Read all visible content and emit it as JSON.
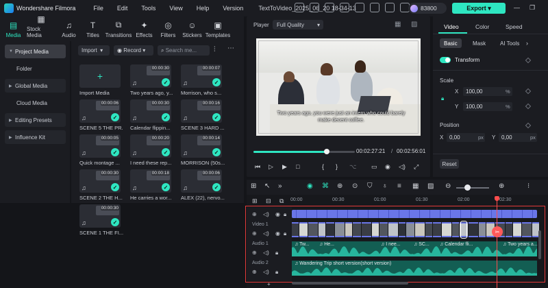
{
  "titlebar": {
    "app_name": "Wondershare Filmora",
    "menus": [
      "File",
      "Edit",
      "Tools",
      "View",
      "Help",
      "Version"
    ],
    "project_name": "TextToVideo_2025_06_20 18-34-13",
    "credits": "83800",
    "export_label": "Export"
  },
  "media_tabs": [
    {
      "label": "Media",
      "icon": "media-icon",
      "active": true
    },
    {
      "label": "Stock Media",
      "icon": "stock-media-icon"
    },
    {
      "label": "Audio",
      "icon": "audio-icon"
    },
    {
      "label": "Titles",
      "icon": "titles-icon"
    },
    {
      "label": "Transitions",
      "icon": "transitions-icon"
    },
    {
      "label": "Effects",
      "icon": "effects-icon"
    },
    {
      "label": "Filters",
      "icon": "filters-icon"
    },
    {
      "label": "Stickers",
      "icon": "stickers-icon"
    },
    {
      "label": "Templates",
      "icon": "templates-icon"
    }
  ],
  "leftnav": {
    "items": [
      {
        "label": "Project Media",
        "selected": true,
        "arrow": true
      },
      {
        "label": "Folder",
        "sub": true
      },
      {
        "label": "Global Media",
        "arrow": true
      },
      {
        "label": "Cloud Media",
        "sub": true
      },
      {
        "label": "Editing Presets",
        "arrow": true
      },
      {
        "label": "Influence Kit",
        "arrow": true
      }
    ]
  },
  "media": {
    "import_label": "Import",
    "record_label": "Record",
    "search_placeholder": "Search me...",
    "import_card_label": "Import Media",
    "items": [
      {
        "label": "Two years ago, y...",
        "duration": "00:00:30"
      },
      {
        "label": "Morrison, who s...",
        "duration": "00:00:07"
      },
      {
        "label": "SCENE 5 THE PR...",
        "duration": "00:00:06"
      },
      {
        "label": "Calendar flippin...",
        "duration": "00:00:30"
      },
      {
        "label": "SCENE 3 HARD ...",
        "duration": "00:00:16"
      },
      {
        "label": "Quick montage ...",
        "duration": "00:00:05"
      },
      {
        "label": "I need these rep...",
        "duration": "00:00:20"
      },
      {
        "label": "MORRISON (50s...",
        "duration": "00:00:14"
      },
      {
        "label": "SCENE 2 THE H...",
        "duration": "00:00:30"
      },
      {
        "label": "He carries a wor...",
        "duration": "00:00:18"
      },
      {
        "label": "ALEX (22), nervo...",
        "duration": "00:00:06"
      },
      {
        "label": "SCENE 1 THE FI...",
        "duration": "00:00:30"
      }
    ]
  },
  "player": {
    "label": "Player",
    "quality": "Full Quality",
    "caption": "Two years ago, you were just an intern who could barely make decent coffee.",
    "current_time": "00:02:27:21",
    "separator": "/",
    "total_time": "00:02:56:01",
    "progress": 0.72
  },
  "properties": {
    "tabs": [
      "Video",
      "Color",
      "Speed"
    ],
    "subtabs": [
      "Basic",
      "Mask",
      "AI Tools"
    ],
    "transform_label": "Transform",
    "scale_label": "Scale",
    "scale_x": "100,00",
    "scale_y": "100,00",
    "scale_unit": "%",
    "position_label": "Position",
    "pos_x": "0,00",
    "pos_y": "0,00",
    "pos_unit": "px",
    "x_label": "X",
    "y_label": "Y",
    "reset_label": "Reset"
  },
  "timeline": {
    "ruler": [
      "00:00",
      "00:30",
      "01:00",
      "01:30",
      "02:00",
      "02:30"
    ],
    "tracks": [
      "Video 1",
      "Audio 1",
      "Audio 2"
    ],
    "audio1_clips": [
      "Tw...",
      "He...",
      "I nee...",
      "SC...",
      "Calendar fli...",
      "Two years a..."
    ],
    "audio2_clip": "Wandering Trip short version(short version)"
  },
  "colors": {
    "accent": "#2ee6c1",
    "playhead": "#ff4d4d",
    "highlight_frame": "#e53a3a",
    "video_clip": "#6a76e8",
    "audio_clip": "#1e9a86"
  }
}
